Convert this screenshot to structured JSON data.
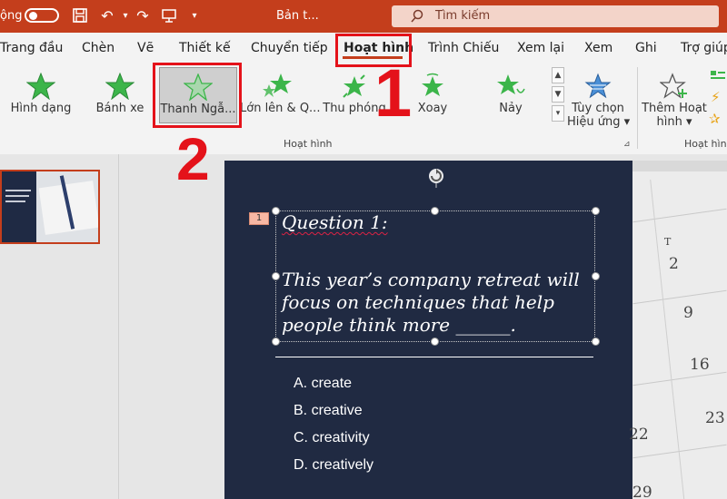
{
  "titlebar": {
    "autosave_label": "ộng",
    "doc_title": "Bản t...",
    "search_placeholder": "Tìm kiếm"
  },
  "tabs": [
    "Trang đầu",
    "Chèn",
    "Vẽ",
    "Thiết kế",
    "Chuyển tiếp",
    "Hoạt hình",
    "Trình Chiếu",
    "Xem lại",
    "Xem",
    "Ghi",
    "Trợ giúp"
  ],
  "active_tab": "Hoạt hình",
  "ribbon": {
    "effects": [
      "Hình dạng",
      "Bánh xe",
      "Thanh Ngẫ...",
      "Lớn lên & Q...",
      "Thu phóng",
      "Xoay",
      "Nảy"
    ],
    "selected_effect": "Thanh Ngẫ...",
    "effect_options": [
      "Tùy chọn",
      "Hiệu ứng ▾"
    ],
    "add_animation": [
      "Thêm Hoạt",
      "hình ▾"
    ],
    "group_label": "Hoạt hình",
    "group_label_right": "Hoạt hình"
  },
  "slide": {
    "animation_tag": "1",
    "question_title": "Question 1:",
    "question_body": "This year’s company retreat will focus on techniques that help people think more ______.",
    "answers": [
      "A. create",
      "B. creative",
      "C. creativity",
      "D. creatively"
    ],
    "calendar": {
      "header": "T",
      "numbers": [
        "2",
        "9",
        "16",
        "23",
        "22",
        "29"
      ]
    }
  },
  "annotations": {
    "step1": "1",
    "step2": "2"
  },
  "colors": {
    "accent": "#c43e1c",
    "slide_bg": "#202a42",
    "star_green": "#3cb54a",
    "annotation_red": "#e4121a"
  }
}
